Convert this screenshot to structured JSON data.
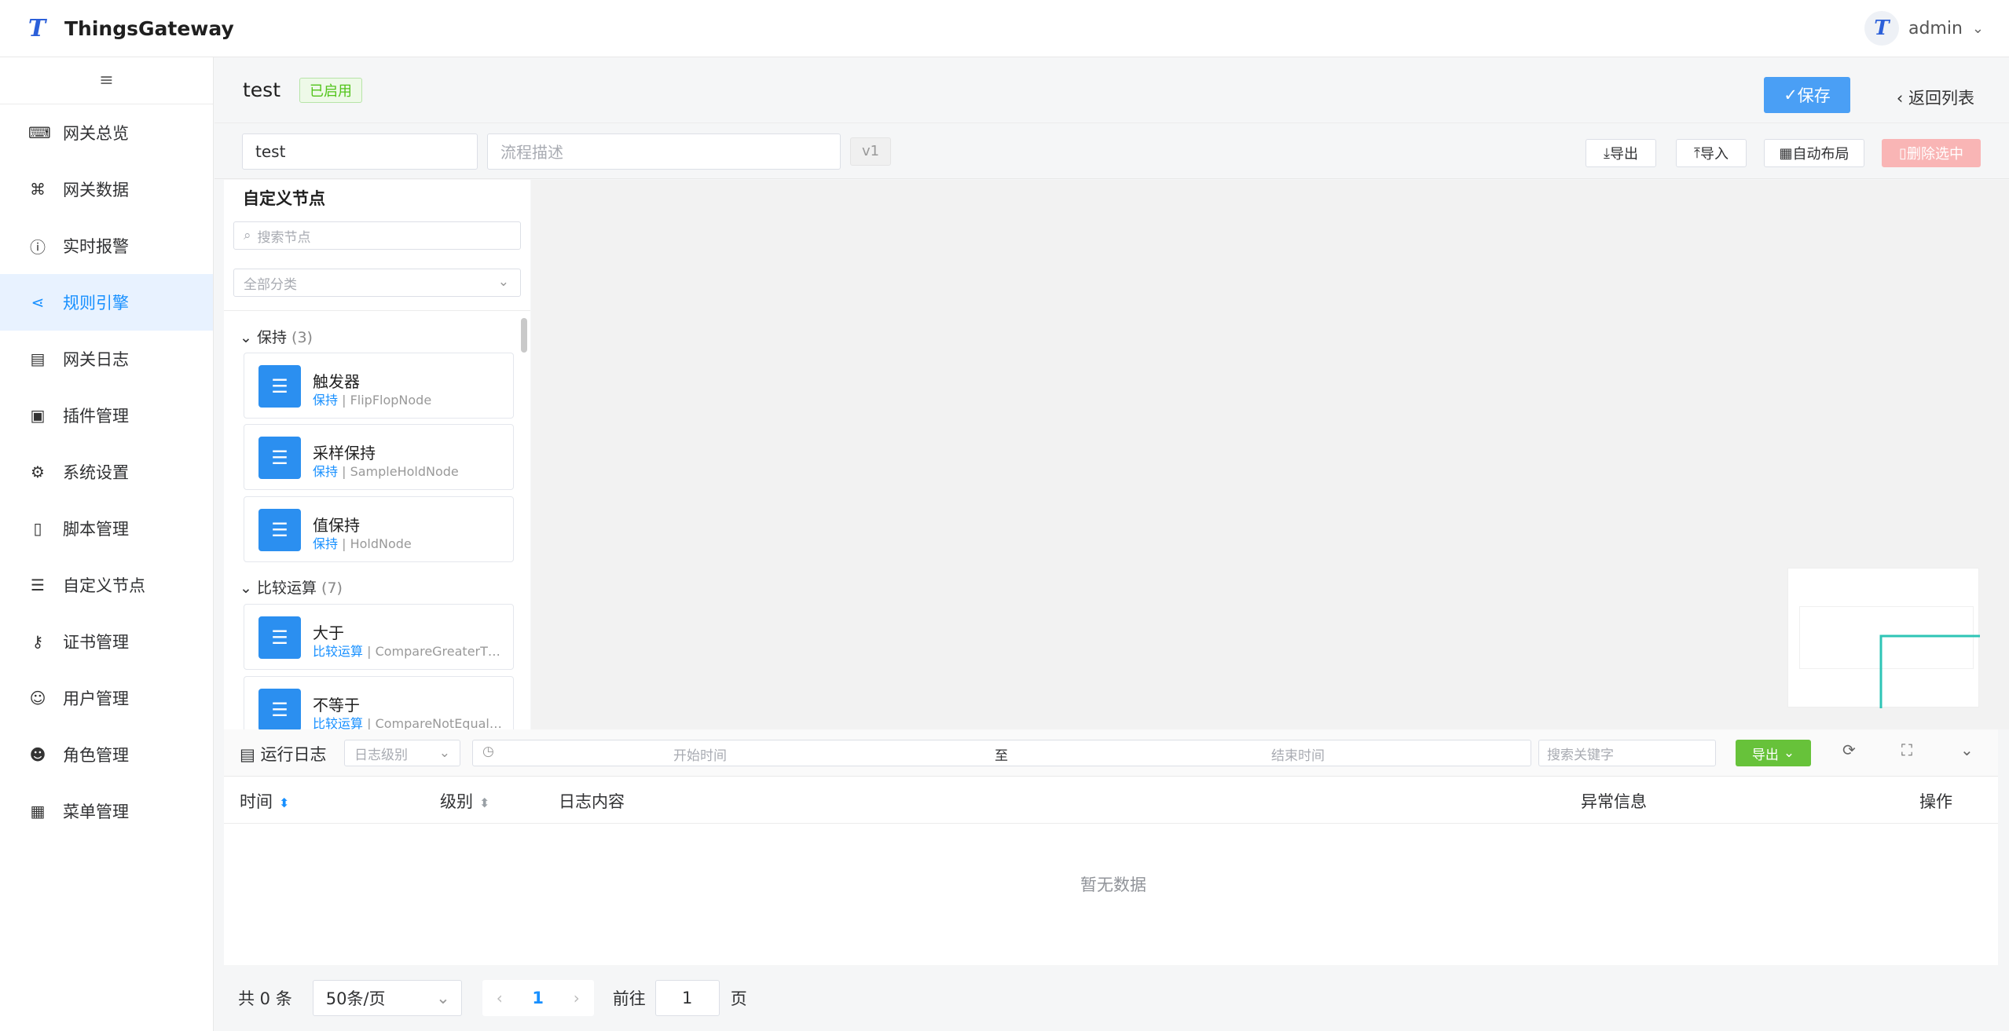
{
  "header": {
    "logo_letter": "T",
    "app_title": "ThingsGateway",
    "user": "admin"
  },
  "sidebar": {
    "items": [
      {
        "label": "网关总览",
        "icon": "monitor-icon",
        "glyph": "⌨"
      },
      {
        "label": "网关数据",
        "icon": "chart-board-icon",
        "glyph": "⌘"
      },
      {
        "label": "实时报警",
        "icon": "alert-circle-icon",
        "glyph": "ⓘ"
      },
      {
        "label": "规则引擎",
        "icon": "share-icon",
        "glyph": "⋖"
      },
      {
        "label": "网关日志",
        "icon": "document-icon",
        "glyph": "▤"
      },
      {
        "label": "插件管理",
        "icon": "package-icon",
        "glyph": "▣"
      },
      {
        "label": "系统设置",
        "icon": "gear-icon",
        "glyph": "⚙"
      },
      {
        "label": "脚本管理",
        "icon": "file-icon",
        "glyph": "▯"
      },
      {
        "label": "自定义节点",
        "icon": "sliders-icon",
        "glyph": "☰"
      },
      {
        "label": "证书管理",
        "icon": "key-icon",
        "glyph": "⚷"
      },
      {
        "label": "用户管理",
        "icon": "user-icon",
        "glyph": "☺"
      },
      {
        "label": "角色管理",
        "icon": "user-solid-icon",
        "glyph": "☻"
      },
      {
        "label": "菜单管理",
        "icon": "grid-icon",
        "glyph": "▦"
      }
    ],
    "active_index": 3
  },
  "titlebar": {
    "name": "test",
    "status": "已启用",
    "save": "保存",
    "back": "返回列表"
  },
  "toolbar": {
    "name_value": "test",
    "desc_placeholder": "流程描述",
    "version": "v1",
    "export": "导出",
    "import": "导入",
    "auto_layout": "自动布局",
    "delete_selected": "删除选中"
  },
  "node_panel": {
    "title": "自定义节点",
    "search_placeholder": "搜索节点",
    "category_select": "全部分类",
    "categories": [
      {
        "name": "保持",
        "count": "(3)"
      },
      {
        "name": "比较运算",
        "count": "(7)"
      }
    ],
    "nodes": [
      {
        "label": "触发器",
        "category": "保持",
        "type": "FlipFlopNode"
      },
      {
        "label": "采样保持",
        "category": "保持",
        "type": "SampleHoldNode"
      },
      {
        "label": "值保持",
        "category": "保持",
        "type": "HoldNode"
      },
      {
        "label": "大于",
        "category": "比较运算",
        "type": "CompareGreaterThanNode"
      },
      {
        "label": "不等于",
        "category": "比较运算",
        "type": "CompareNotEqualNode"
      }
    ]
  },
  "log": {
    "title": "运行日志",
    "level_placeholder": "日志级别",
    "start_placeholder": "开始时间",
    "range_sep": "至",
    "end_placeholder": "结束时间",
    "keyword_placeholder": "搜索关键字",
    "export": "导出",
    "columns": [
      "时间",
      "级别",
      "日志内容",
      "异常信息",
      "操作"
    ],
    "empty": "暂无数据"
  },
  "pager": {
    "total": "共 0 条",
    "page_size": "50条/页",
    "current": "1",
    "goto": "前往",
    "goto_value": "1",
    "unit": "页"
  }
}
